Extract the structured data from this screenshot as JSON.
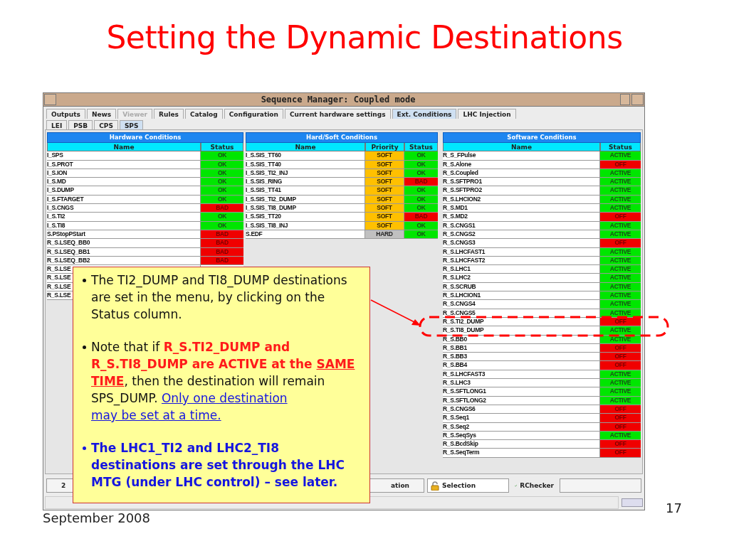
{
  "slide": {
    "title": "Setting the Dynamic Destinations",
    "date": "September 2008",
    "page_number": "17"
  },
  "window": {
    "title": "Sequence Manager: Coupled mode",
    "tabs": [
      {
        "label": "Outputs",
        "selected": false,
        "disabled": false
      },
      {
        "label": "News",
        "selected": false,
        "disabled": false
      },
      {
        "label": "Viewer",
        "selected": false,
        "disabled": true
      },
      {
        "label": "Rules",
        "selected": false,
        "disabled": false
      },
      {
        "label": "Catalog",
        "selected": false,
        "disabled": false
      },
      {
        "label": "Configuration",
        "selected": false,
        "disabled": false
      },
      {
        "label": "Current hardware settings",
        "selected": false,
        "disabled": false
      },
      {
        "label": "Ext. Conditions",
        "selected": true,
        "disabled": false
      },
      {
        "label": "LHC Injection",
        "selected": false,
        "disabled": false
      }
    ],
    "subtabs": [
      {
        "label": "LEI",
        "selected": false
      },
      {
        "label": "PSB",
        "selected": false
      },
      {
        "label": "CPS",
        "selected": false
      },
      {
        "label": "SPS",
        "selected": true
      }
    ],
    "tables": [
      {
        "kind": "hardware",
        "title": "Hardware Conditions",
        "columns": [
          "Name",
          "Status"
        ],
        "rows": [
          {
            "name": "I_SPS",
            "status": "OK",
            "ok": true
          },
          {
            "name": "I_S.PROT",
            "status": "OK",
            "ok": true
          },
          {
            "name": "I_S.ION",
            "status": "OK",
            "ok": true
          },
          {
            "name": "I_S.MD",
            "status": "OK",
            "ok": true
          },
          {
            "name": "I_S.DUMP",
            "status": "OK",
            "ok": true
          },
          {
            "name": "I_S.FTARGET",
            "status": "OK",
            "ok": true
          },
          {
            "name": "I_S.CNGS",
            "status": "BAD",
            "ok": false
          },
          {
            "name": "I_S.TI2",
            "status": "OK",
            "ok": true
          },
          {
            "name": "I_S.TI8",
            "status": "OK",
            "ok": true
          },
          {
            "name": "S.PStopPStart",
            "status": "BAD",
            "ok": false
          },
          {
            "name": "R_S.LSEQ_BB0",
            "status": "BAD",
            "ok": false
          },
          {
            "name": "R_S.LSEQ_BB1",
            "status": "BAD",
            "ok": false
          },
          {
            "name": "R_S.LSEQ_BB2",
            "status": "BAD",
            "ok": false
          },
          {
            "name": "R_S.LSE"
          },
          {
            "name": "R_S.LSE"
          },
          {
            "name": "R_S.LSE"
          },
          {
            "name": "R_S.LSE"
          }
        ]
      },
      {
        "kind": "hardsoft",
        "title": "Hard/Soft Conditions",
        "columns": [
          "Name",
          "Priority",
          "Status"
        ],
        "rows": [
          {
            "name": "I_S.SIS_TT60",
            "priority": "SOFT",
            "hard": false,
            "status": "OK",
            "ok": true
          },
          {
            "name": "I_S.SIS_TT40",
            "priority": "SOFT",
            "hard": false,
            "status": "OK",
            "ok": true
          },
          {
            "name": "I_S.SIS_TI2_INJ",
            "priority": "SOFT",
            "hard": false,
            "status": "OK",
            "ok": true
          },
          {
            "name": "I_S.SIS_RING",
            "priority": "SOFT",
            "hard": false,
            "status": "BAD",
            "ok": false
          },
          {
            "name": "I_S.SIS_TT41",
            "priority": "SOFT",
            "hard": false,
            "status": "OK",
            "ok": true
          },
          {
            "name": "I_S.SIS_TI2_DUMP",
            "priority": "SOFT",
            "hard": false,
            "status": "OK",
            "ok": true
          },
          {
            "name": "I_S.SIS_TI8_DUMP",
            "priority": "SOFT",
            "hard": false,
            "status": "OK",
            "ok": true
          },
          {
            "name": "I_S.SIS_TT20",
            "priority": "SOFT",
            "hard": false,
            "status": "BAD",
            "ok": false
          },
          {
            "name": "I_S.SIS_TI8_INJ",
            "priority": "SOFT",
            "hard": false,
            "status": "OK",
            "ok": true
          },
          {
            "name": "S.EDF",
            "priority": "HARD",
            "hard": true,
            "status": "OK",
            "ok": true
          }
        ]
      },
      {
        "kind": "software",
        "title": "Software Conditions",
        "columns": [
          "Name",
          "Status"
        ],
        "rows": [
          {
            "name": "R_S_FPulse",
            "status": "ACTIVE",
            "ok": true
          },
          {
            "name": "R_S.Alone",
            "status": "OFF",
            "ok": false
          },
          {
            "name": "R_S.Coupled",
            "status": "ACTIVE",
            "ok": true
          },
          {
            "name": "R_S.SFTPRO1",
            "status": "ACTIVE",
            "ok": true
          },
          {
            "name": "R_S.SFTPRO2",
            "status": "ACTIVE",
            "ok": true
          },
          {
            "name": "R_S.LHCION2",
            "status": "ACTIVE",
            "ok": true
          },
          {
            "name": "R_S.MD1",
            "status": "ACTIVE",
            "ok": true
          },
          {
            "name": "R_S.MD2",
            "status": "OFF",
            "ok": false
          },
          {
            "name": "R_S.CNGS1",
            "status": "ACTIVE",
            "ok": true
          },
          {
            "name": "R_S.CNGS2",
            "status": "ACTIVE",
            "ok": true
          },
          {
            "name": "R_S.CNGS3",
            "status": "OFF",
            "ok": false
          },
          {
            "name": "R_S.LHCFAST1",
            "status": "ACTIVE",
            "ok": true
          },
          {
            "name": "R_S.LHCFAST2",
            "status": "ACTIVE",
            "ok": true
          },
          {
            "name": "R_S.LHC1",
            "status": "ACTIVE",
            "ok": true
          },
          {
            "name": "R_S.LHC2",
            "status": "ACTIVE",
            "ok": true
          },
          {
            "name": "R_S.SCRUB",
            "status": "ACTIVE",
            "ok": true
          },
          {
            "name": "R_S.LHCION1",
            "status": "ACTIVE",
            "ok": true
          },
          {
            "name": "R_S.CNGS4",
            "status": "ACTIVE",
            "ok": true
          },
          {
            "name": "R_S.CNGS5",
            "status": "ACTIVE",
            "ok": true
          },
          {
            "name": "R_S.TI2_DUMP",
            "status": "OFF",
            "ok": false
          },
          {
            "name": "R_S.TI8_DUMP",
            "status": "ACTIVE",
            "ok": true
          },
          {
            "name": "R_S.BB0",
            "status": "ACTIVE",
            "ok": true
          },
          {
            "name": "R_S.BB1",
            "status": "OFF",
            "ok": false
          },
          {
            "name": "R_S.BB3",
            "status": "OFF",
            "ok": false
          },
          {
            "name": "R_S.BB4",
            "status": "OFF",
            "ok": false
          },
          {
            "name": "R_S.LHCFAST3",
            "status": "ACTIVE",
            "ok": true
          },
          {
            "name": "R_S.LHC3",
            "status": "ACTIVE",
            "ok": true
          },
          {
            "name": "R_S.SFTLONG1",
            "status": "ACTIVE",
            "ok": true
          },
          {
            "name": "R_S.SFTLONG2",
            "status": "ACTIVE",
            "ok": true
          },
          {
            "name": "R_S.CNGS6",
            "status": "OFF",
            "ok": false
          },
          {
            "name": "R_S.Seq1",
            "status": "OFF",
            "ok": false
          },
          {
            "name": "R_S.Seq2",
            "status": "OFF",
            "ok": false
          },
          {
            "name": "R_S.SeqSys",
            "status": "ACTIVE",
            "ok": true
          },
          {
            "name": "R_S.BcdSkip",
            "status": "OFF",
            "ok": false
          },
          {
            "name": "R_S.SeqTerm",
            "status": "OFF",
            "ok": false
          }
        ]
      }
    ],
    "status_bar": [
      {
        "kind": "left",
        "text": "2"
      },
      {
        "kind": "right",
        "text": "ation"
      },
      {
        "kind": "lock",
        "text": "Selection"
      },
      {
        "kind": "check",
        "text": "RChecker"
      },
      {
        "kind": "field"
      }
    ]
  },
  "callout": {
    "bullets": [
      {
        "kind": "plain",
        "segments": [
          {
            "kind": "plain",
            "text": "The TI2_DUMP and TI8_DUMP destinations are set in the menu, by clicking on the Status column."
          }
        ]
      },
      {
        "kind": "plain",
        "segments": [
          {
            "kind": "plain",
            "text": "Note that if "
          },
          {
            "kind": "alert",
            "text": "R_S.TI2_DUMP and R_S.TI8_DUMP are ACTIVE at the "
          },
          {
            "kind": "emphasis",
            "text": "SAME TIME"
          },
          {
            "kind": "plain",
            "text": ", then the destination will remain SPS_DUMP. "
          },
          {
            "kind": "link",
            "text": "Only one destination"
          },
          {
            "kind": "link",
            "text": "may be set at a time."
          }
        ]
      },
      {
        "kind": "note",
        "segments": [
          {
            "kind": "plain",
            "text": "The LHC1_TI2 and LHC2_TI8 destinations are set through the LHC MTG (under LHC control) – see later."
          }
        ]
      }
    ]
  }
}
